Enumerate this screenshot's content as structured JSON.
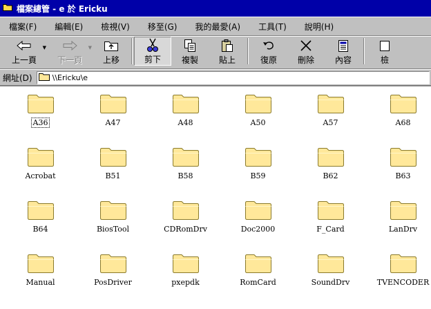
{
  "window": {
    "title": "檔案總管 - e 於 Ericku"
  },
  "menu": [
    {
      "id": "file",
      "label": "檔案(F)"
    },
    {
      "id": "edit",
      "label": "編輯(E)"
    },
    {
      "id": "view",
      "label": "檢視(V)"
    },
    {
      "id": "goto",
      "label": "移至(G)"
    },
    {
      "id": "favorites",
      "label": "我的最愛(A)"
    },
    {
      "id": "tools",
      "label": "工具(T)"
    },
    {
      "id": "help",
      "label": "說明(H)"
    }
  ],
  "toolbar": {
    "back": "上一頁",
    "forward": "下一頁",
    "up": "上移",
    "cut": "剪下",
    "copy": "複製",
    "paste": "貼上",
    "undo": "復原",
    "delete": "刪除",
    "properties": "內容",
    "views": "檢"
  },
  "address": {
    "label": "網址(D)",
    "value": "\\\\Ericku\\e"
  },
  "files": [
    "A36",
    "A47",
    "A48",
    "A50",
    "A57",
    "A68",
    "Acrobat",
    "B51",
    "B58",
    "B59",
    "B62",
    "B63",
    "B64",
    "BiosTool",
    "CDRomDrv",
    "Doc2000",
    "F_Card",
    "LanDrv",
    "Manual",
    "PosDriver",
    "pxepdk",
    "RomCard",
    "SoundDrv",
    "TVENCODER"
  ],
  "colors": {
    "titlebar": "#0000a8",
    "chrome": "#c0c0c0",
    "folder": "#ffe89a",
    "folder_outline": "#8a7a2a"
  }
}
